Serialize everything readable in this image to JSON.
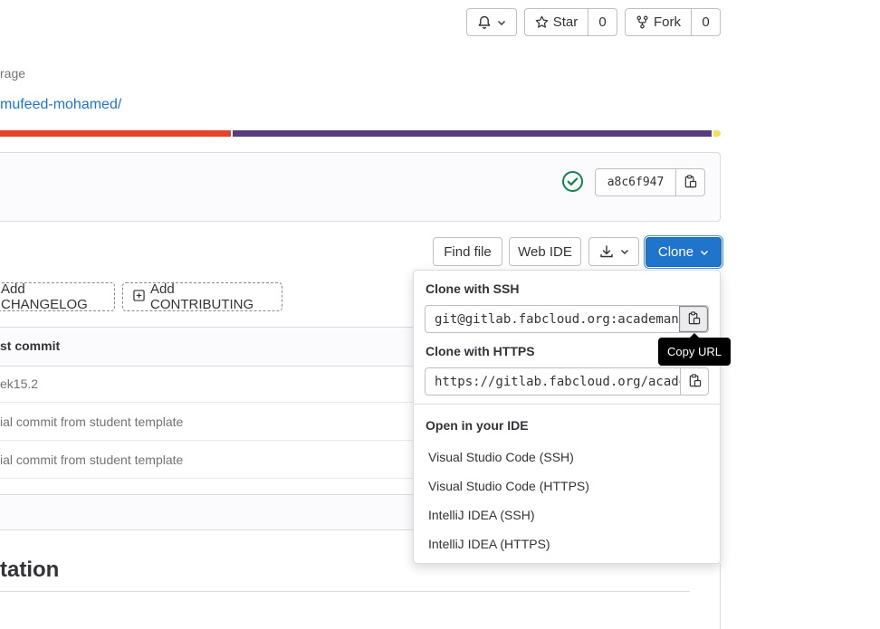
{
  "header": {
    "notify_button": "notifications",
    "star_label": "Star",
    "star_count": "0",
    "fork_label": "Fork",
    "fork_count": "0"
  },
  "project": {
    "partial_label": "rage",
    "partial_link": "mufeed-mohamed/"
  },
  "language_bar": [
    {
      "color": "#e24329",
      "fraction": 0.318
    },
    {
      "color": "#563d7c",
      "fraction": 0.67
    },
    {
      "color": "#f1e05a",
      "fraction": 0.012
    }
  ],
  "commit": {
    "sha": "a8c6f947",
    "status": "passed"
  },
  "toolbar": {
    "find_file": "Find file",
    "web_ide": "Web IDE",
    "clone": "Clone"
  },
  "add_buttons": {
    "changelog": "Add CHANGELOG",
    "contributing": "Add CONTRIBUTING"
  },
  "file_table": {
    "header": "st commit",
    "rows": [
      "ek15.2",
      "ial commit from student template",
      "ial commit from student template"
    ]
  },
  "readme": {
    "heading_partial": "tation"
  },
  "clone_dropdown": {
    "ssh_header": "Clone with SSH",
    "ssh_url": "git@gitlab.fabcloud.org:academany",
    "https_header": "Clone with HTTPS",
    "https_url": "https://gitlab.fabcloud.org/academany",
    "ide_header": "Open in your IDE",
    "ide_items": [
      "Visual Studio Code (SSH)",
      "Visual Studio Code (HTTPS)",
      "IntelliJ IDEA (SSH)",
      "IntelliJ IDEA (HTTPS)"
    ]
  },
  "tooltip": {
    "text": "Copy URL"
  },
  "colors": {
    "primary": "#1f75cb",
    "success": "#108548"
  }
}
